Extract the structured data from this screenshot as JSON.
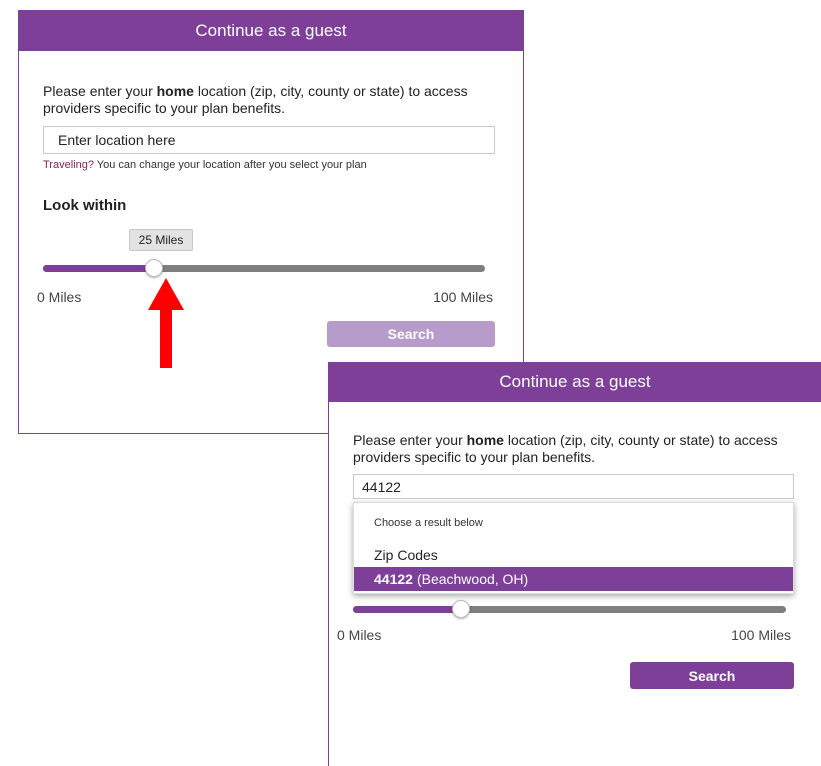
{
  "panel_back": {
    "title": "Continue as a guest",
    "desc_before": "Please enter your ",
    "desc_bold": "home",
    "desc_after": " location (zip, city, county or state) to access providers specific to your plan benefits.",
    "location_placeholder": "Enter location here",
    "hint_traveling": "Traveling?",
    "hint_rest": " You can change your location after you select your plan",
    "look_within": "Look within",
    "distance_value": "25 Miles",
    "distance_fraction": 0.25,
    "min_label": "0 Miles",
    "max_label": "100 Miles",
    "search_label": "Search",
    "search_color": "#b79ccb"
  },
  "panel_front": {
    "title": "Continue as a guest",
    "desc_before": "Please enter your ",
    "desc_bold": "home",
    "desc_after": " location (zip, city, county or state) to access providers specific to your plan benefits.",
    "location_value": "44122",
    "dropdown": {
      "heading": "Choose a result below",
      "group": "Zip Codes",
      "result_bold": "44122",
      "result_rest": "(Beachwood, OH)"
    },
    "distance_fraction": 0.25,
    "min_label": "0 Miles",
    "max_label": "100 Miles",
    "search_label": "Search",
    "search_color": "#7d3f98"
  },
  "annotation": {
    "arrow_icon": "red-up-arrow-icon",
    "arrow_color": "#ff0000"
  },
  "colors": {
    "brand_purple": "#7d3f98",
    "track_gray": "#7f7f7f"
  }
}
